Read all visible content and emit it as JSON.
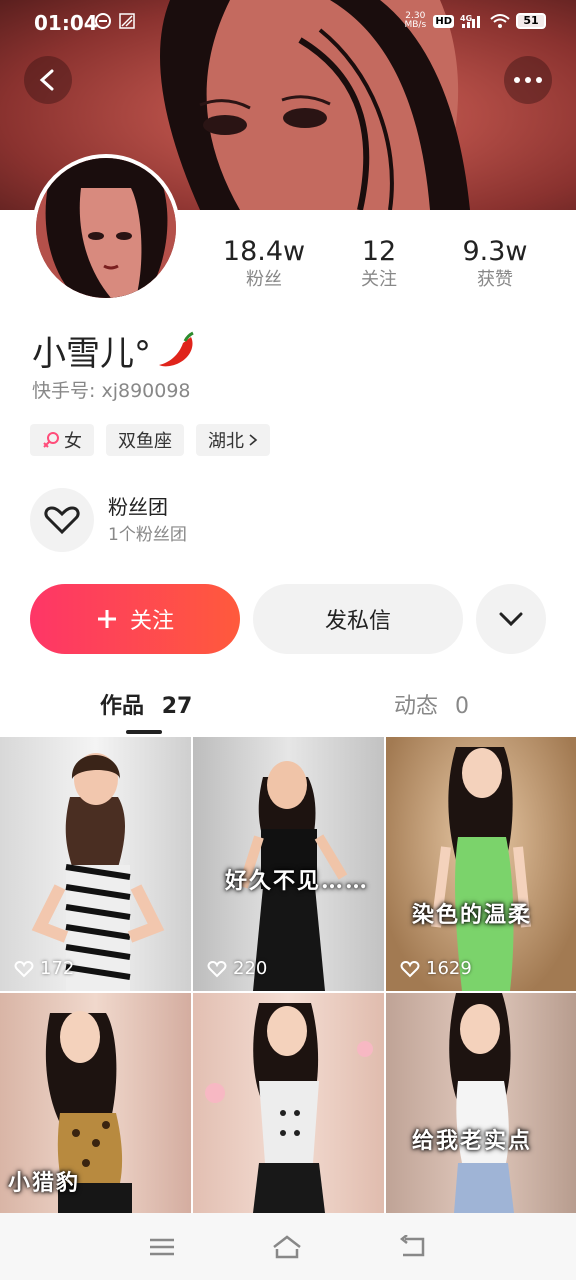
{
  "status_bar": {
    "time": "01:04",
    "net_speed_value": "2.30",
    "net_speed_unit": "MB/s",
    "hd_label": "HD",
    "network": "4G",
    "battery": "51"
  },
  "profile": {
    "username": "小雪儿°",
    "id_label": "快手号:",
    "id_value": "xj890098",
    "stats": [
      {
        "value": "18.4w",
        "label": "粉丝"
      },
      {
        "value": "12",
        "label": "关注"
      },
      {
        "value": "9.3w",
        "label": "获赞"
      }
    ],
    "tags": {
      "gender": "女",
      "zodiac": "双鱼座",
      "location": "湖北"
    },
    "fan_club": {
      "title": "粉丝团",
      "subtitle": "1个粉丝团"
    }
  },
  "actions": {
    "follow_label": "关注",
    "message_label": "发私信"
  },
  "tabs": {
    "works_label": "作品",
    "works_count": "27",
    "dynamic_label": "动态",
    "dynamic_count": "0"
  },
  "videos": [
    {
      "likes": "172",
      "caption": ""
    },
    {
      "likes": "220",
      "caption": "好久不见……"
    },
    {
      "likes": "1629",
      "caption": "染色的温柔"
    },
    {
      "likes": "",
      "caption": "小猎豹"
    },
    {
      "likes": "",
      "caption": ""
    },
    {
      "likes": "",
      "caption": "给我老实点"
    }
  ],
  "colors": {
    "accent": "#fe3667",
    "accent_end": "#ff5a3c",
    "banner": "#b14c45"
  }
}
